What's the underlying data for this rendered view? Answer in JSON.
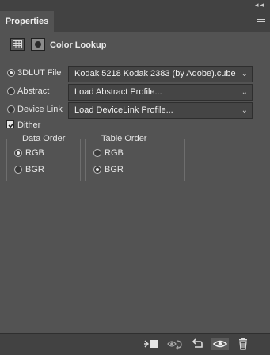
{
  "panel": {
    "tab_label": "Properties",
    "collapse_glyph": "◂◂",
    "title": "Color Lookup",
    "icons": [
      "adjustment-grid-icon",
      "mask-icon"
    ]
  },
  "sources": [
    {
      "label": "3DLUT File",
      "selected": true,
      "dropdown": "Kodak 5218 Kodak 2383 (by Adobe).cube"
    },
    {
      "label": "Abstract",
      "selected": false,
      "dropdown": "Load Abstract Profile..."
    },
    {
      "label": "Device Link",
      "selected": false,
      "dropdown": "Load DeviceLink Profile..."
    }
  ],
  "dither": {
    "label": "Dither",
    "checked": true
  },
  "data_order": {
    "legend": "Data Order",
    "options": [
      "RGB",
      "BGR"
    ],
    "selected": "RGB"
  },
  "table_order": {
    "legend": "Table Order",
    "options": [
      "RGB",
      "BGR"
    ],
    "selected": "BGR"
  },
  "footer_icons": [
    "clip-to-layer-icon",
    "view-previous-state-icon",
    "reset-icon",
    "visibility-eye-icon",
    "trash-icon"
  ],
  "colors": {
    "panel_bg": "#535353",
    "tab_bar_bg": "#424242",
    "field_bg": "#454545",
    "text": "#e6e6e6"
  }
}
